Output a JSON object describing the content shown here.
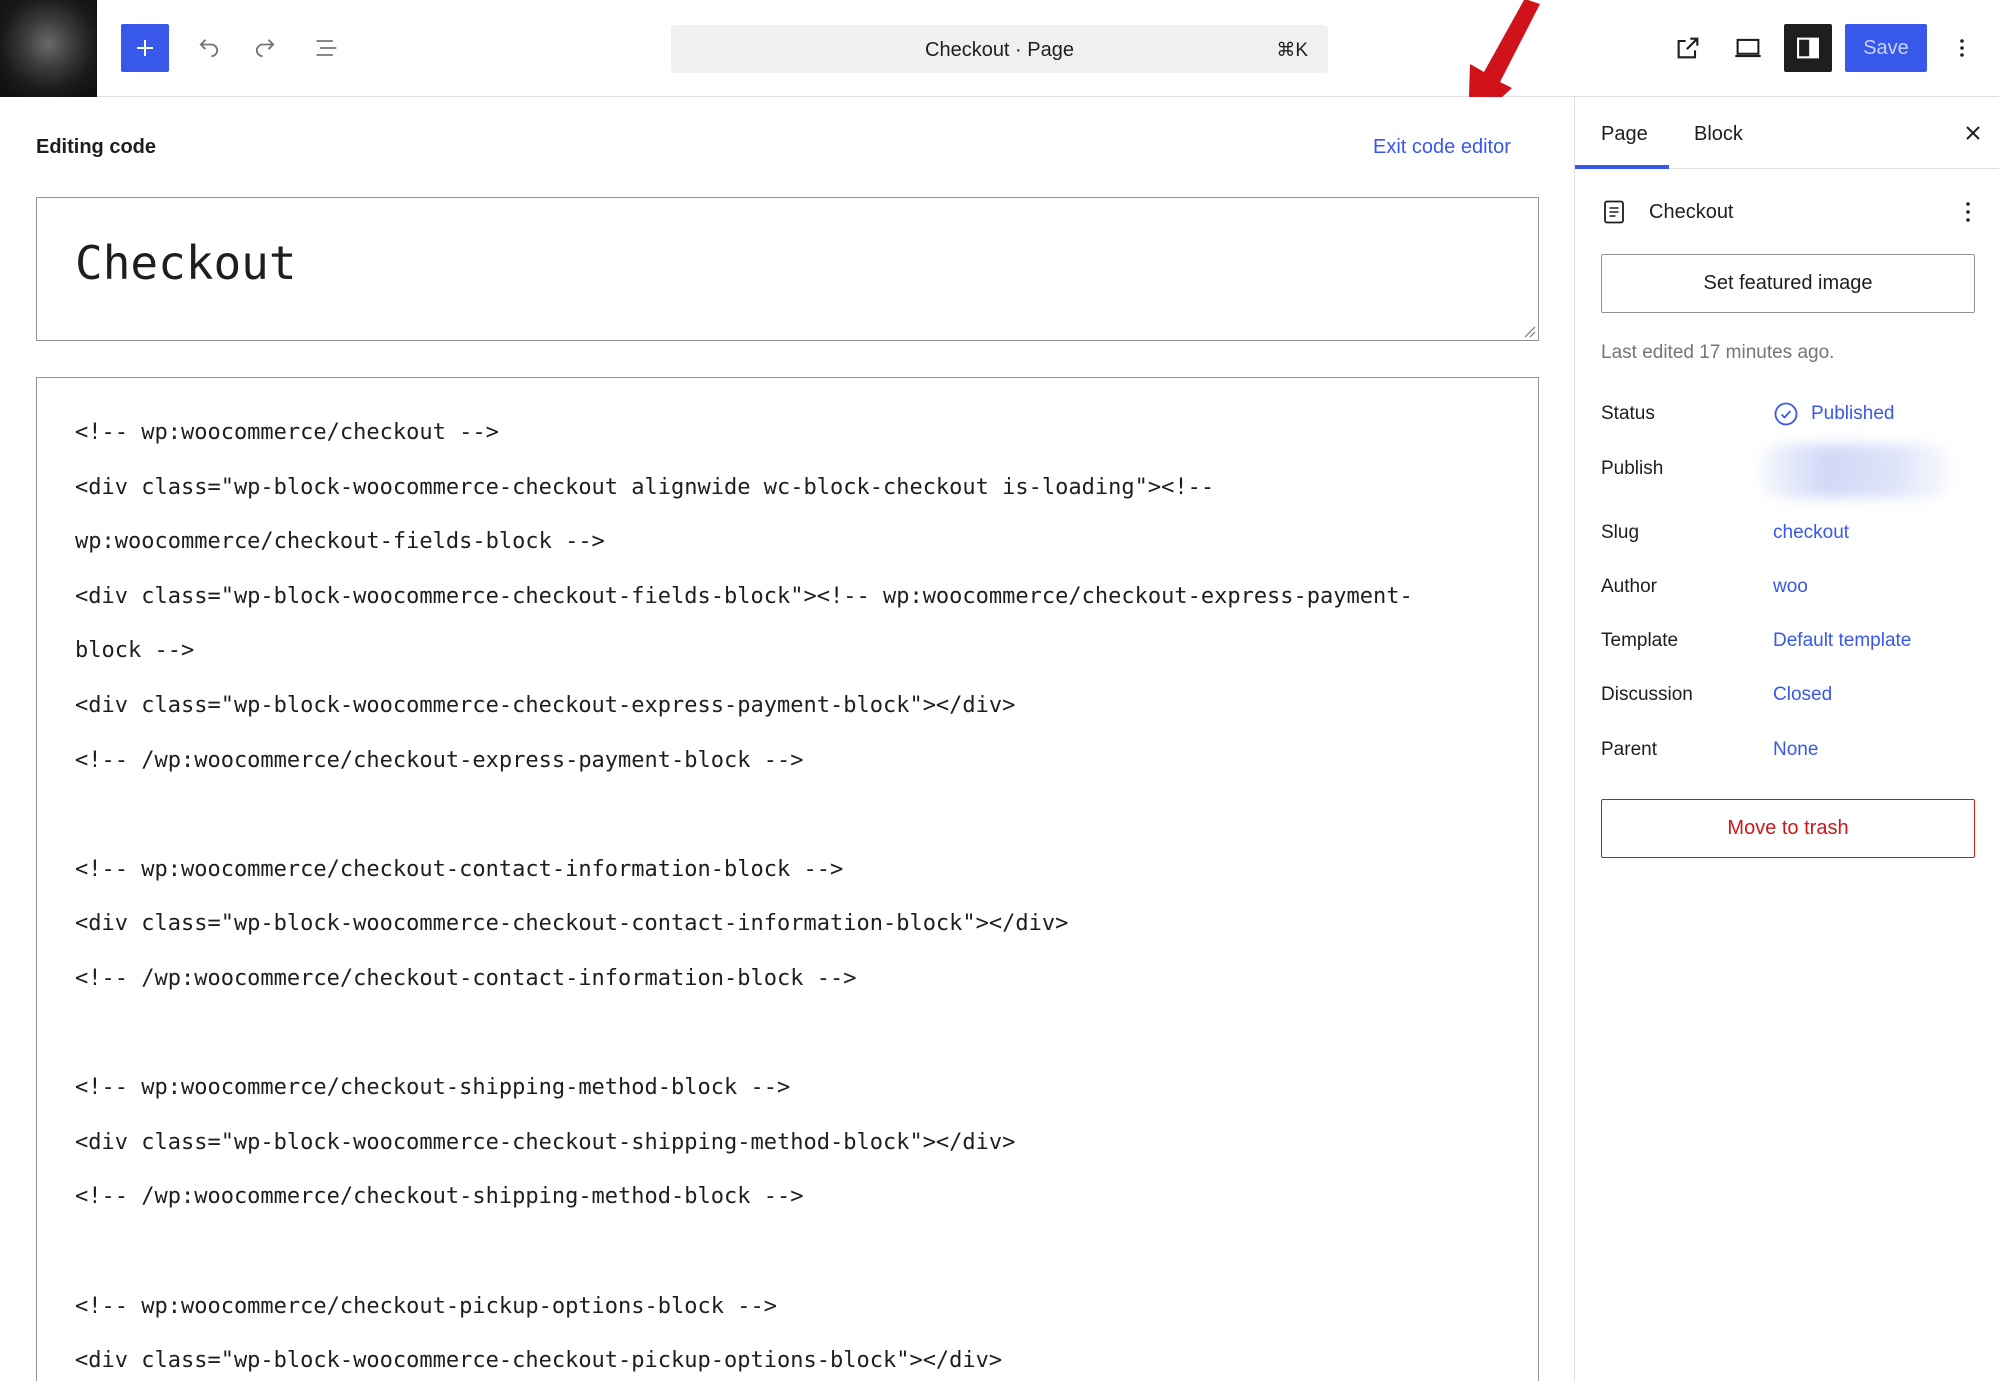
{
  "toolbar": {
    "site_logo_icon": "site-logo-icon",
    "inserter_icon": "plus-icon",
    "undo_icon": "undo-icon",
    "redo_icon": "redo-icon",
    "list_view_icon": "list-view-icon",
    "command": {
      "title": "Checkout · Page",
      "shortcut": "⌘K"
    },
    "view_icon": "external-link-icon",
    "preview_icon": "desktop-preview-icon",
    "settings_icon": "sidebar-toggle-icon",
    "save_label": "Save",
    "options_icon": "more-vertical-icon",
    "accent_color": "#3858e9"
  },
  "annotation": {
    "arrow_icon": "red-arrow-icon",
    "color": "#d0121b"
  },
  "editor": {
    "mode_label": "Editing code",
    "exit_label": "Exit code editor",
    "title_value": "Checkout",
    "code_lines": [
      "<!-- wp:woocommerce/checkout -->",
      "<div class=\"wp-block-woocommerce-checkout alignwide wc-block-checkout is-loading\"><!--",
      "wp:woocommerce/checkout-fields-block -->",
      "<div class=\"wp-block-woocommerce-checkout-fields-block\"><!-- wp:woocommerce/checkout-express-payment-",
      "block -->",
      "<div class=\"wp-block-woocommerce-checkout-express-payment-block\"></div>",
      "<!-- /wp:woocommerce/checkout-express-payment-block -->",
      "",
      "<!-- wp:woocommerce/checkout-contact-information-block -->",
      "<div class=\"wp-block-woocommerce-checkout-contact-information-block\"></div>",
      "<!-- /wp:woocommerce/checkout-contact-information-block -->",
      "",
      "<!-- wp:woocommerce/checkout-shipping-method-block -->",
      "<div class=\"wp-block-woocommerce-checkout-shipping-method-block\"></div>",
      "<!-- /wp:woocommerce/checkout-shipping-method-block -->",
      "",
      "<!-- wp:woocommerce/checkout-pickup-options-block -->",
      "<div class=\"wp-block-woocommerce-checkout-pickup-options-block\"></div>"
    ]
  },
  "sidebar": {
    "tabs": [
      {
        "label": "Page",
        "active": true
      },
      {
        "label": "Block",
        "active": false
      }
    ],
    "close_icon": "close-icon",
    "document": {
      "icon": "page-icon",
      "title": "Checkout",
      "more_icon": "more-vertical-icon"
    },
    "featured_image_label": "Set featured image",
    "last_edited": "Last edited 17 minutes ago.",
    "meta": {
      "status": {
        "label": "Status",
        "value": "Published",
        "icon": "published-check-icon"
      },
      "publish": {
        "label": "Publish"
      },
      "slug": {
        "label": "Slug",
        "value": "checkout"
      },
      "author": {
        "label": "Author",
        "value": "woo"
      },
      "template": {
        "label": "Template",
        "value": "Default template"
      },
      "discussion": {
        "label": "Discussion",
        "value": "Closed"
      },
      "parent": {
        "label": "Parent",
        "value": "None"
      }
    },
    "trash_label": "Move to trash",
    "danger_color": "#cc1818"
  }
}
